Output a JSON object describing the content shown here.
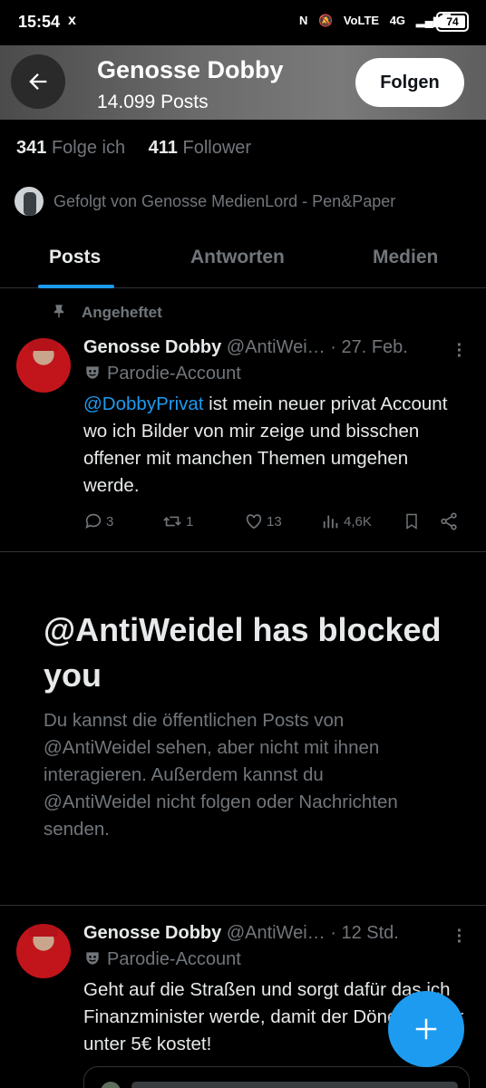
{
  "status_bar": {
    "time": "15:54",
    "x_icon": "x",
    "network": "VoLTE",
    "network_gen": "4G",
    "battery": "74"
  },
  "header": {
    "name": "Genosse Dobby",
    "posts_count": "14.099 Posts",
    "follow_label": "Folgen"
  },
  "profile": {
    "following_count": "341",
    "following_label": "Folge ich",
    "followers_count": "411",
    "followers_label": "Follower",
    "followed_by": "Gefolgt von Genosse MedienLord - Pen&Paper"
  },
  "tabs": [
    {
      "label": "Posts",
      "active": true
    },
    {
      "label": "Antworten",
      "active": false
    },
    {
      "label": "Medien",
      "active": false
    }
  ],
  "pinned_label": "Angeheftet",
  "tweets": [
    {
      "name": "Genosse Dobby",
      "handle": "@AntiWei…",
      "time": "· 27. Feb.",
      "badge": "Parodie-Account",
      "mention": "@DobbyPrivat",
      "text": " ist mein neuer privat Account wo ich Bilder von mir zeige und bisschen offener mit manchen Themen umgehen werde.",
      "replies": "3",
      "reposts": "1",
      "likes": "13",
      "views": "4,6K"
    },
    {
      "name": "Genosse Dobby",
      "handle": "@AntiWei…",
      "time": "· 12 Std.",
      "badge": "Parodie-Account",
      "text": "Geht auf die Straßen und sorgt dafür das ich Finanzminister werde, damit der Döner wieder unter 5€ kostet!"
    }
  ],
  "blocked": {
    "title": "@AntiWeidel has blocked you",
    "text": "Du kannst die öffentlichen Posts von @AntiWeidel sehen, aber nicht mit ihnen interagieren. Außerdem kannst du @AntiWeidel nicht folgen oder Nachrichten senden."
  },
  "colors": {
    "accent": "#1d9bf0",
    "background": "#000000",
    "muted_text": "#71767b",
    "divider": "#2f3336"
  },
  "icons": [
    "back-arrow-icon",
    "pin-icon",
    "theater-mask-icon",
    "more-icon",
    "reply-icon",
    "repost-icon",
    "like-icon",
    "views-icon",
    "bookmark-icon",
    "share-icon",
    "plus-icon"
  ]
}
